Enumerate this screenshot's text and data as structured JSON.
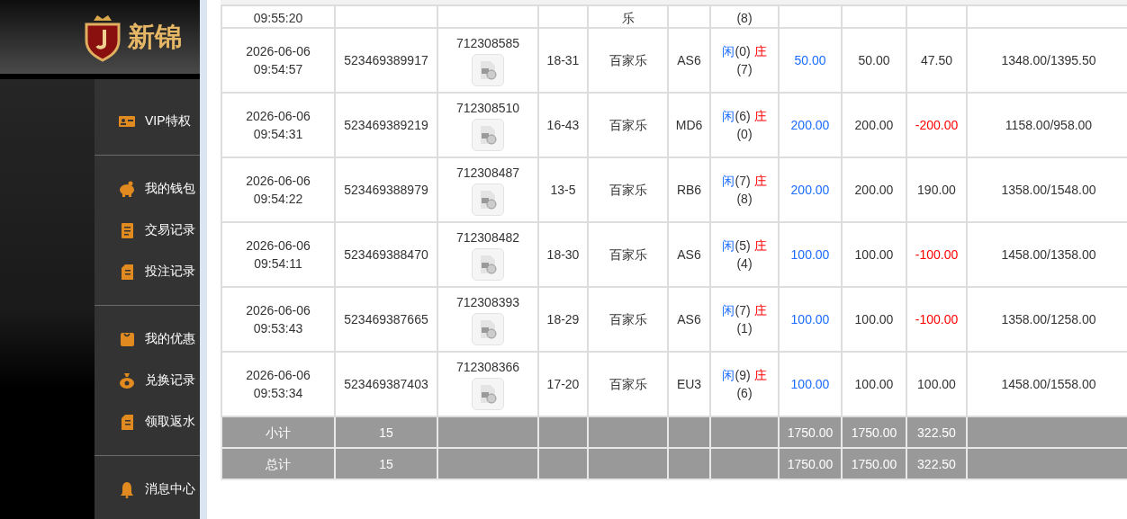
{
  "logo": {
    "text": "新锦"
  },
  "menu": [
    {
      "group": [
        {
          "label": "VIP特权"
        }
      ]
    },
    {
      "group": [
        {
          "label": "我的钱包"
        },
        {
          "label": "交易记录"
        },
        {
          "label": "投注记录"
        }
      ]
    },
    {
      "group": [
        {
          "label": "我的优惠"
        },
        {
          "label": "兑换记录"
        },
        {
          "label": "领取返水"
        }
      ]
    },
    {
      "group": [
        {
          "label": "消息中心"
        }
      ]
    }
  ],
  "partial_row": {
    "time": "09:55:20",
    "game": "乐",
    "banker_score": "(8)"
  },
  "rows": [
    {
      "date": "2026-06-06",
      "time": "09:54:57",
      "bet_id": "523469389917",
      "round": "712308585",
      "shoe": "18-31",
      "game": "百家乐",
      "table": "AS6",
      "player": "闲",
      "player_score": "(0)",
      "banker": "庄",
      "banker_score": "(7)",
      "bet": "50.00",
      "valid": "50.00",
      "win": "47.50",
      "loss": false,
      "balance": "1348.00/1395.50"
    },
    {
      "date": "2026-06-06",
      "time": "09:54:31",
      "bet_id": "523469389219",
      "round": "712308510",
      "shoe": "16-43",
      "game": "百家乐",
      "table": "MD6",
      "player": "闲",
      "player_score": "(6)",
      "banker": "庄",
      "banker_score": "(0)",
      "bet": "200.00",
      "valid": "200.00",
      "win": "-200.00",
      "loss": true,
      "balance": "1158.00/958.00"
    },
    {
      "date": "2026-06-06",
      "time": "09:54:22",
      "bet_id": "523469388979",
      "round": "712308487",
      "shoe": "13-5",
      "game": "百家乐",
      "table": "RB6",
      "player": "闲",
      "player_score": "(7)",
      "banker": "庄",
      "banker_score": "(8)",
      "bet": "200.00",
      "valid": "200.00",
      "win": "190.00",
      "loss": false,
      "balance": "1358.00/1548.00"
    },
    {
      "date": "2026-06-06",
      "time": "09:54:11",
      "bet_id": "523469388470",
      "round": "712308482",
      "shoe": "18-30",
      "game": "百家乐",
      "table": "AS6",
      "player": "闲",
      "player_score": "(5)",
      "banker": "庄",
      "banker_score": "(4)",
      "bet": "100.00",
      "valid": "100.00",
      "win": "-100.00",
      "loss": true,
      "balance": "1458.00/1358.00"
    },
    {
      "date": "2026-06-06",
      "time": "09:53:43",
      "bet_id": "523469387665",
      "round": "712308393",
      "shoe": "18-29",
      "game": "百家乐",
      "table": "AS6",
      "player": "闲",
      "player_score": "(7)",
      "banker": "庄",
      "banker_score": "(1)",
      "bet": "100.00",
      "valid": "100.00",
      "win": "-100.00",
      "loss": true,
      "balance": "1358.00/1258.00"
    },
    {
      "date": "2026-06-06",
      "time": "09:53:34",
      "bet_id": "523469387403",
      "round": "712308366",
      "shoe": "17-20",
      "game": "百家乐",
      "table": "EU3",
      "player": "闲",
      "player_score": "(9)",
      "banker": "庄",
      "banker_score": "(6)",
      "bet": "100.00",
      "valid": "100.00",
      "win": "100.00",
      "loss": false,
      "balance": "1458.00/1558.00"
    }
  ],
  "totals": [
    {
      "label": "小计",
      "count": "15",
      "bet": "1750.00",
      "valid": "1750.00",
      "win": "322.50"
    },
    {
      "label": "总计",
      "count": "15",
      "bet": "1750.00",
      "valid": "1750.00",
      "win": "322.50"
    }
  ]
}
